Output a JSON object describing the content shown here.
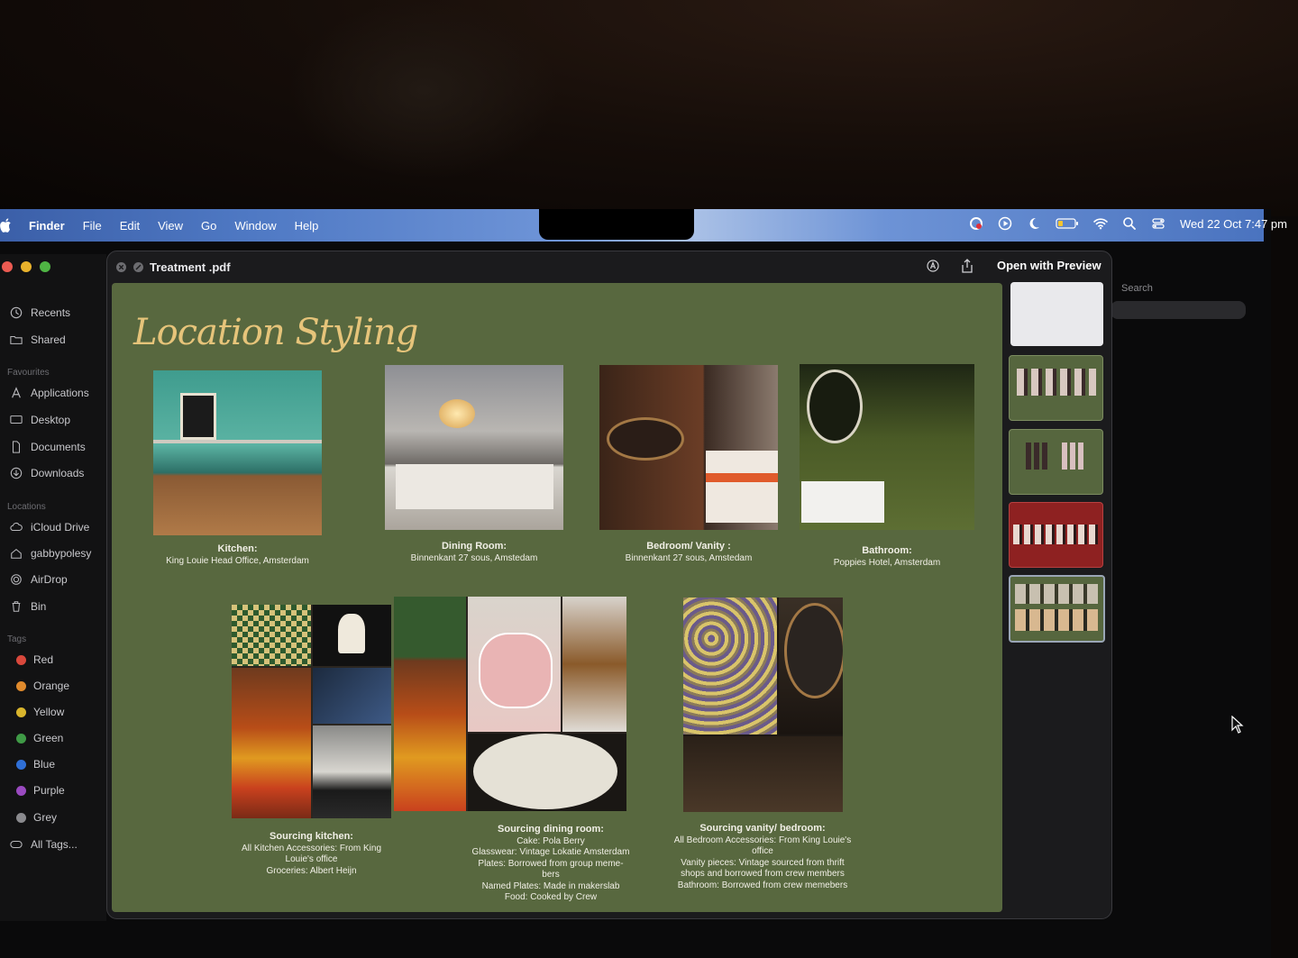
{
  "menubar": {
    "items": [
      "Finder",
      "File",
      "Edit",
      "View",
      "Go",
      "Window",
      "Help"
    ],
    "datetime": "Wed 22 Oct  7:47 pm"
  },
  "sidebar": {
    "top_items": [
      "Recents",
      "Shared"
    ],
    "favourites_heading": "Favourites",
    "favourites": [
      "Applications",
      "Desktop",
      "Documents",
      "Downloads"
    ],
    "locations_heading": "Locations",
    "locations": [
      "iCloud Drive",
      "gabbypolesy",
      "AirDrop",
      "Bin"
    ],
    "tags_heading": "Tags",
    "tags": [
      {
        "label": "Red",
        "color": "#d9483c"
      },
      {
        "label": "Orange",
        "color": "#e08a2c"
      },
      {
        "label": "Yellow",
        "color": "#d9b52c"
      },
      {
        "label": "Green",
        "color": "#3f9a46"
      },
      {
        "label": "Blue",
        "color": "#2f6fd6"
      },
      {
        "label": "Purple",
        "color": "#9a4ac0"
      },
      {
        "label": "Grey",
        "color": "#8a8a8e"
      }
    ],
    "all_tags": "All Tags..."
  },
  "quicklook": {
    "title": "Treatment .pdf",
    "open_with": "Open with Preview"
  },
  "finder_search_label": "Search",
  "slide": {
    "title": "Location Styling",
    "locations": [
      {
        "name": "Kitchen:",
        "address": "King Louie Head Office, Amsterdam"
      },
      {
        "name": "Dining Room:",
        "address": "Binnenkant 27 sous, Amstedam"
      },
      {
        "name": "Bedroom/ Vanity :",
        "address": "Binnenkant 27 sous, Amstedam"
      },
      {
        "name": "Bathroom:",
        "address": "Poppies Hotel, Amsterdam"
      }
    ],
    "sourcing": [
      {
        "heading": "Sourcing kitchen:",
        "lines": [
          "All Kitchen Accessories: From King",
          "Louie's office",
          "Groceries: Albert Heijn"
        ]
      },
      {
        "heading": "Sourcing dining room:",
        "lines": [
          "Cake: Pola Berry",
          "Glasswear: Vintage Lokatie Amsterdam",
          "Plates: Borrowed from group meme-",
          "bers",
          "Named Plates: Made in makerslab",
          "Food: Cooked by Crew"
        ]
      },
      {
        "heading": "Sourcing vanity/ bedroom:",
        "lines": [
          "All Bedroom Accessories: From King Louie's",
          "office",
          "Vanity pieces: Vintage sourced from thrift",
          "shops and borrowed from crew members",
          "Bathroom: Borrowed from crew memebers"
        ]
      }
    ]
  },
  "colors": {
    "slide_bg": "#58683f",
    "title_gold": "#e6c47a",
    "thumb_red": "#8e2121"
  }
}
